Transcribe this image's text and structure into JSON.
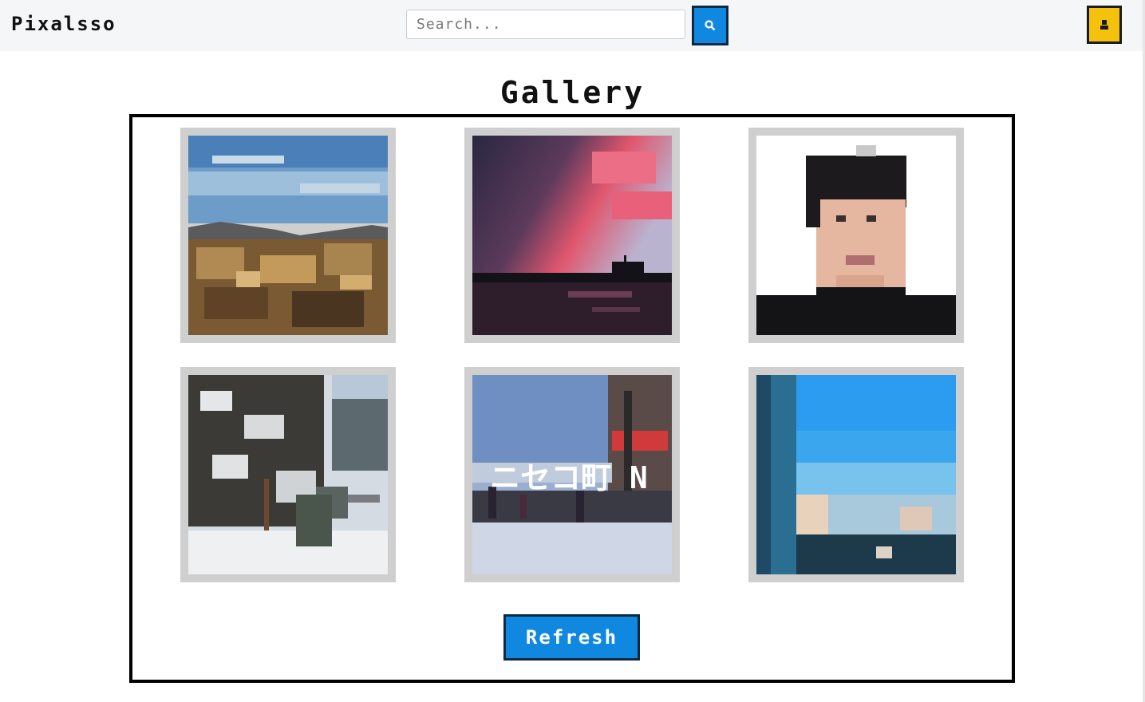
{
  "app": {
    "title": "Pixalsso"
  },
  "search": {
    "placeholder": "Search..."
  },
  "main": {
    "title": "Gallery",
    "refresh_label": "Refresh",
    "images": [
      {
        "name": "mountain-forest"
      },
      {
        "name": "sunset-pier"
      },
      {
        "name": "portrait"
      },
      {
        "name": "snowy-trees"
      },
      {
        "name": "niseko-street",
        "overlay_text": "ニセコ町 N"
      },
      {
        "name": "window-sky"
      }
    ]
  },
  "colors": {
    "accent": "#1088e0",
    "avatar": "#f4c20d",
    "frame": "#cfcfcf"
  }
}
